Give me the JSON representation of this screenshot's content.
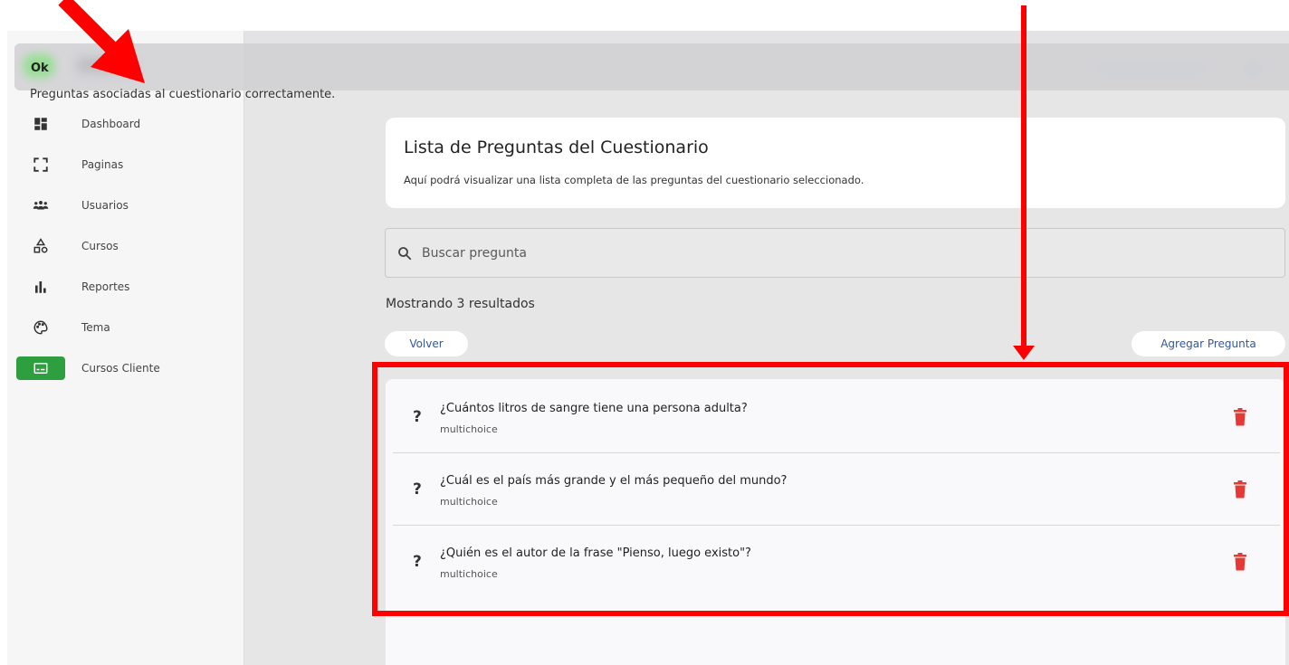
{
  "toast": {
    "title": "Ok",
    "message": "Preguntas asociadas al cuestionario correctamente."
  },
  "sidebar": {
    "items": [
      {
        "label": "Dashboard",
        "icon": "dashboard-icon"
      },
      {
        "label": "Paginas",
        "icon": "pages-icon"
      },
      {
        "label": "Usuarios",
        "icon": "users-icon"
      },
      {
        "label": "Cursos",
        "icon": "shapes-icon"
      },
      {
        "label": "Reportes",
        "icon": "bar-chart-icon"
      },
      {
        "label": "Tema",
        "icon": "palette-icon"
      },
      {
        "label": "Cursos Cliente",
        "icon": "subtitles-icon",
        "active": true
      }
    ],
    "active_color": "#2e9f3e"
  },
  "header": {
    "title": "Lista de Preguntas del Cuestionario",
    "subtitle": "Aquí podrá visualizar una lista completa de las preguntas del cuestionario seleccionado."
  },
  "search": {
    "placeholder": "Buscar pregunta",
    "value": ""
  },
  "results": {
    "count_text": "Mostrando 3 resultados"
  },
  "actions": {
    "back_label": "Volver",
    "add_label": "Agregar Pregunta"
  },
  "questions": [
    {
      "mark": "?",
      "text": "¿Cuántos litros de sangre tiene una persona adulta?",
      "type": "multichoice"
    },
    {
      "mark": "?",
      "text": "¿Cuál es el país más grande y el más pequeño del mundo?",
      "type": "multichoice"
    },
    {
      "mark": "?",
      "text": "¿Quién es el autor de la frase \"Pienso, luego existo\"?",
      "type": "multichoice"
    }
  ],
  "colors": {
    "annotation": "#ff0000",
    "delete": "#e53935",
    "link": "#2f57a6"
  }
}
